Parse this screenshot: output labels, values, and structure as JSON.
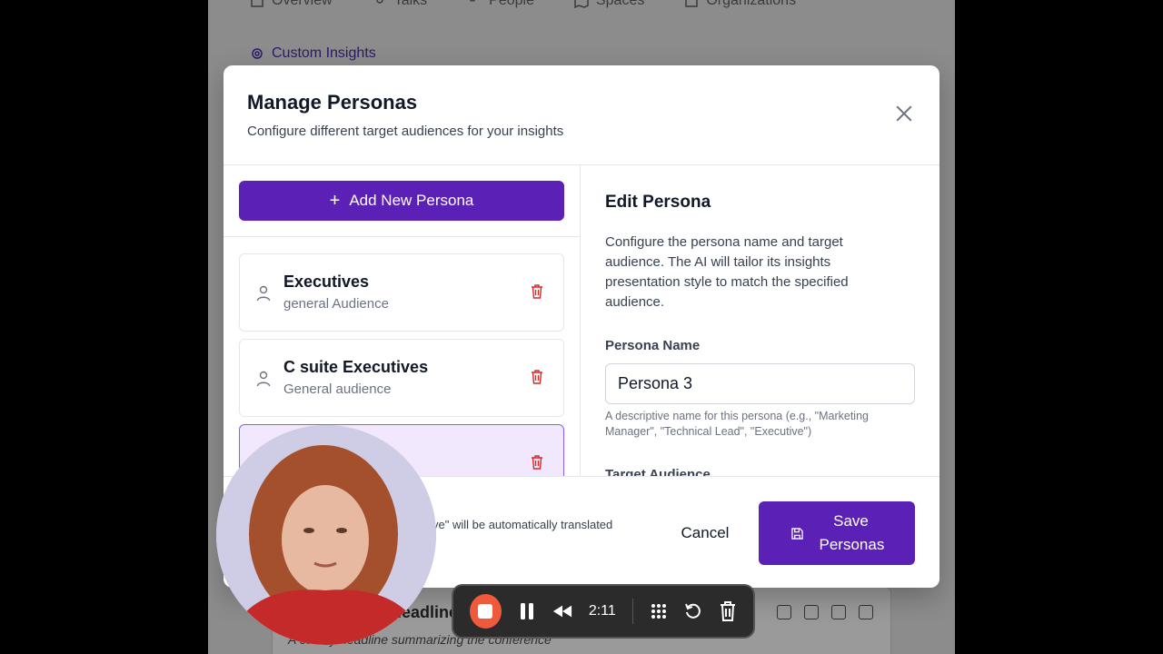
{
  "background": {
    "nav": [
      "Overview",
      "Talks",
      "People",
      "Spaces",
      "Organizations"
    ],
    "custom_insights": "Custom Insights",
    "headline": "Headline",
    "headline_sub": "A catchy headline summarizing the conference"
  },
  "modal": {
    "title": "Manage Personas",
    "subtitle": "Configure different target audiences for your insights",
    "add_button": "Add New Persona",
    "personas": [
      {
        "name": "Executives",
        "audience": "general Audience"
      },
      {
        "name": "C suite Executives",
        "audience": "General audience"
      },
      {
        "name": "",
        "audience": ""
      }
    ],
    "edit": {
      "title": "Edit Persona",
      "description": "Configure the persona name and target audience. The AI will tailor its insights presentation style to match the specified audience.",
      "name_label": "Persona Name",
      "name_value": "Persona 3",
      "hint": "A descriptive name for this persona (e.g., \"Marketing Manager\", \"Technical Lead\", \"Executive\")",
      "audience_label": "Target Audience"
    },
    "footer_note": "ve\" will be automatically translated",
    "cancel": "Cancel",
    "save": "Save Personas"
  },
  "recorder": {
    "time": "2:11",
    "stop_color": "#f05a3c"
  },
  "colors": {
    "accent": "#5b21b6",
    "trash": "#dc2626"
  }
}
